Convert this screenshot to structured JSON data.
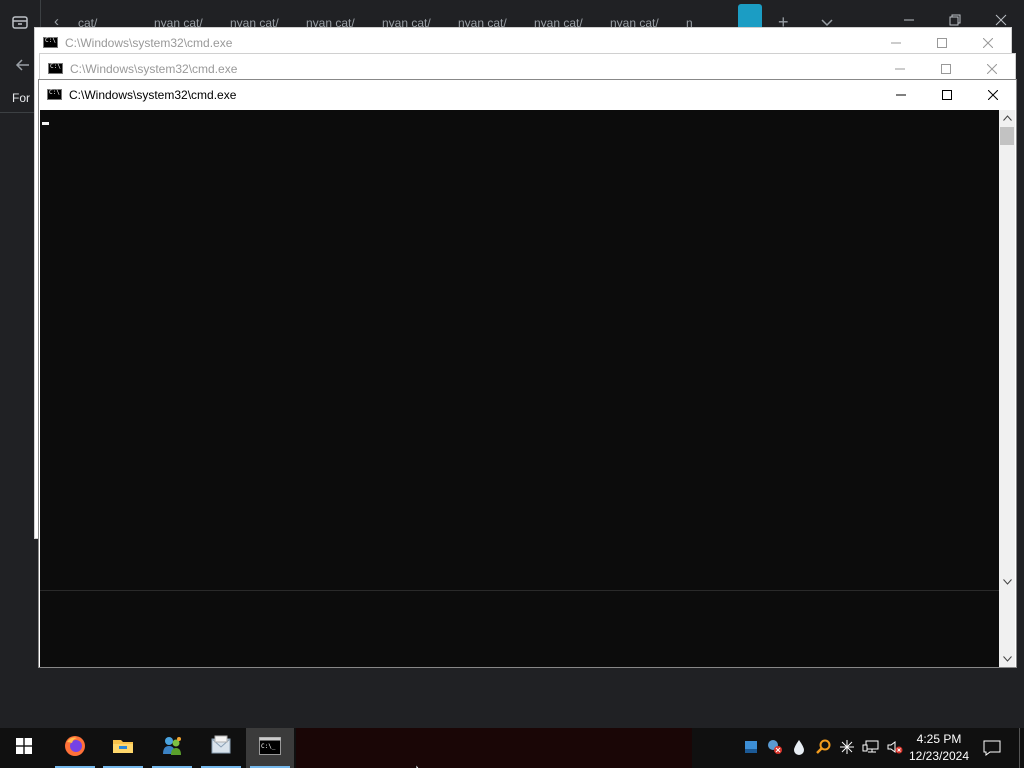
{
  "browser": {
    "tabs": [
      "cat/",
      "nyan cat/",
      "nyan cat/",
      "nyan cat/",
      "nyan cat/",
      "nyan cat/",
      "nyan cat/",
      "nyan cat/",
      "nyan cat/",
      "n"
    ],
    "side_text": "For"
  },
  "windows": [
    {
      "title": "C:\\Windows\\system32\\cmd.exe",
      "state": "inactive"
    },
    {
      "title": "C:\\Windows\\system32\\cmd.exe",
      "state": "inactive"
    },
    {
      "title": "C:\\Windows\\system32\\cmd.exe",
      "state": "active"
    }
  ],
  "taskbar": {
    "apps": [
      {
        "name": "Firefox",
        "icon": "firefox-icon"
      },
      {
        "name": "File Explorer",
        "icon": "folder-icon"
      },
      {
        "name": "Windows Live Messenger",
        "icon": "messenger-icon"
      },
      {
        "name": "Windows Mail",
        "icon": "mail-icon"
      },
      {
        "name": "Command Prompt",
        "icon": "cmd-icon"
      }
    ],
    "tray_icons": [
      "taskbar-app-icon",
      "network-warning-icon",
      "water-drop-icon",
      "magnifier-icon",
      "snowflake-icon",
      "network-icon",
      "volume-muted-icon"
    ],
    "time": "4:25 PM",
    "date": "12/23/2024"
  },
  "colors": {
    "browser_bg": "#202124",
    "console_bg": "#0c0c0c",
    "taskbar_bg": "#101010",
    "accent": "#76b9ed",
    "active_tab": "#1b9dc4"
  }
}
